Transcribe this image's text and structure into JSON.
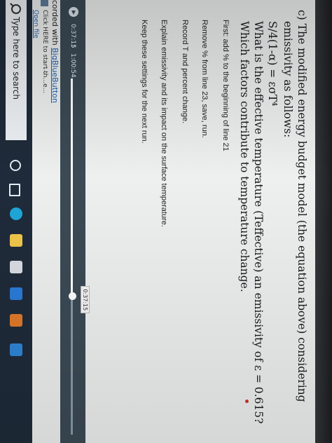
{
  "question": {
    "title": "c) The modified energy budget model (the equation above) considering",
    "emissivity_line": "emissivity as follows:",
    "formula": "S/4(1-α) = εσT⁴",
    "effective_line": "What is the effective temperature (Teffective) an emissivity of ε = 0.615?",
    "factors_line": "Which factors contribute to temperature change."
  },
  "steps": [
    "First: add % to the beginning of line 21",
    "Remove % from line 23, save, run.",
    "Record T and percent change.",
    "Explain emissivity and its impact on the surface temperature.",
    "Keep these settings for the next run."
  ],
  "player": {
    "current_time": "0:37:15",
    "separator": "/",
    "total_time": "1:00:54",
    "progress": 0.611,
    "tooltip_time": "0:37:15"
  },
  "footer": {
    "recorded_prefix": "corded with ",
    "recorded_link": "BigBlueButton",
    "file_name": "Click HERE to start th...e...",
    "file_menu": "...",
    "open_file": "Open file"
  },
  "taskbar": {
    "search_placeholder": "Type here to search",
    "icons": [
      "cortana-icon",
      "task-view-icon",
      "edge-icon",
      "file-explorer-icon",
      "store-icon",
      "outlook-icon",
      "app-icon",
      "blue-app-icon"
    ]
  },
  "colors": {
    "player_bg": "#3b4a55",
    "taskbar_bg": "#1f2b3a",
    "link": "#1a5fb4",
    "page_bg": "#eef0ef"
  }
}
